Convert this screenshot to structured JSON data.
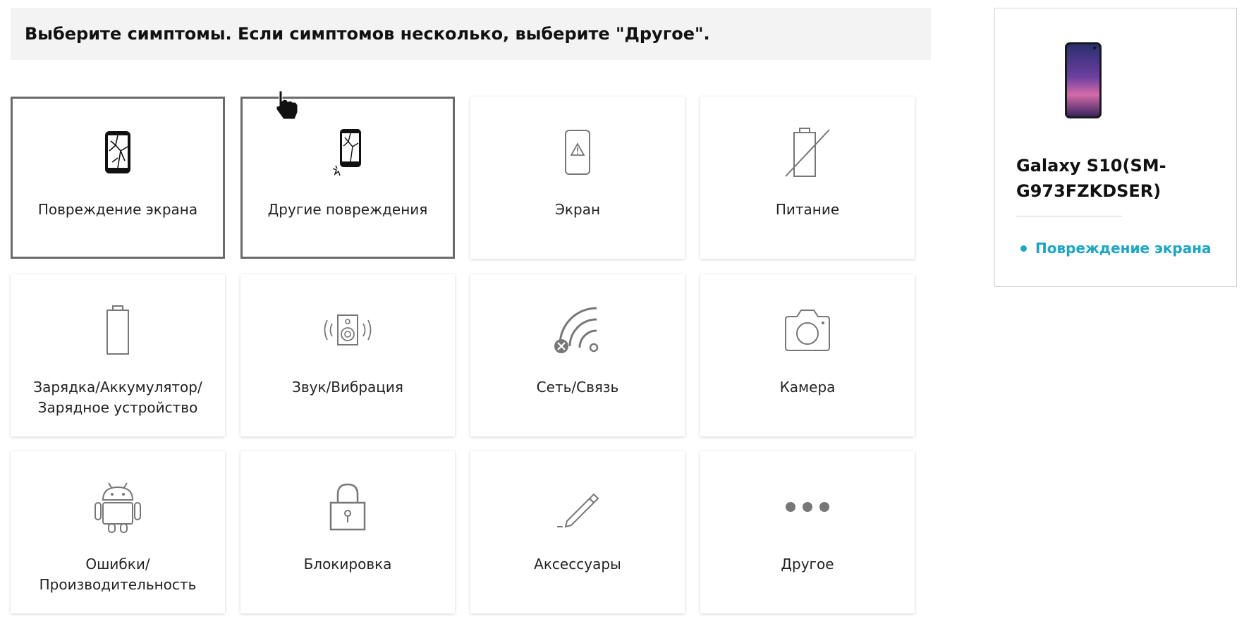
{
  "instruction": "Выберите симптомы. Если симптомов несколько, выберите \"Другое\".",
  "symptoms": [
    {
      "label": "Повреждение экрана",
      "icon": "cracked-screen-icon",
      "selected": true
    },
    {
      "label": "Другие повреждения",
      "icon": "damaged-phone-icon",
      "selected": true
    },
    {
      "label": "Экран",
      "icon": "screen-warning-icon",
      "selected": false
    },
    {
      "label": "Питание",
      "icon": "power-off-battery-icon",
      "selected": false
    },
    {
      "label": "Зарядка/Аккумулятор/ Зарядное устройство",
      "icon": "battery-icon",
      "selected": false
    },
    {
      "label": "Звук/Вибрация",
      "icon": "speaker-vibration-icon",
      "selected": false
    },
    {
      "label": "Сеть/Связь",
      "icon": "network-off-icon",
      "selected": false
    },
    {
      "label": "Камера",
      "icon": "camera-icon",
      "selected": false
    },
    {
      "label": "Ошибки/ Производительность",
      "icon": "android-icon",
      "selected": false
    },
    {
      "label": "Блокировка",
      "icon": "lock-icon",
      "selected": false
    },
    {
      "label": "Аксессуары",
      "icon": "pen-icon",
      "selected": false
    },
    {
      "label": "Другое",
      "icon": "more-dots-icon",
      "selected": false
    }
  ],
  "device": {
    "name": "Galaxy S10(SM-G973FZKDSER)",
    "selected_symptom": "Повреждение экрана"
  },
  "colors": {
    "accent": "#1aa6c8",
    "icon_stroke": "#777777",
    "selected_border": "#6b6b6b",
    "instruction_bg": "#f3f3f3"
  }
}
